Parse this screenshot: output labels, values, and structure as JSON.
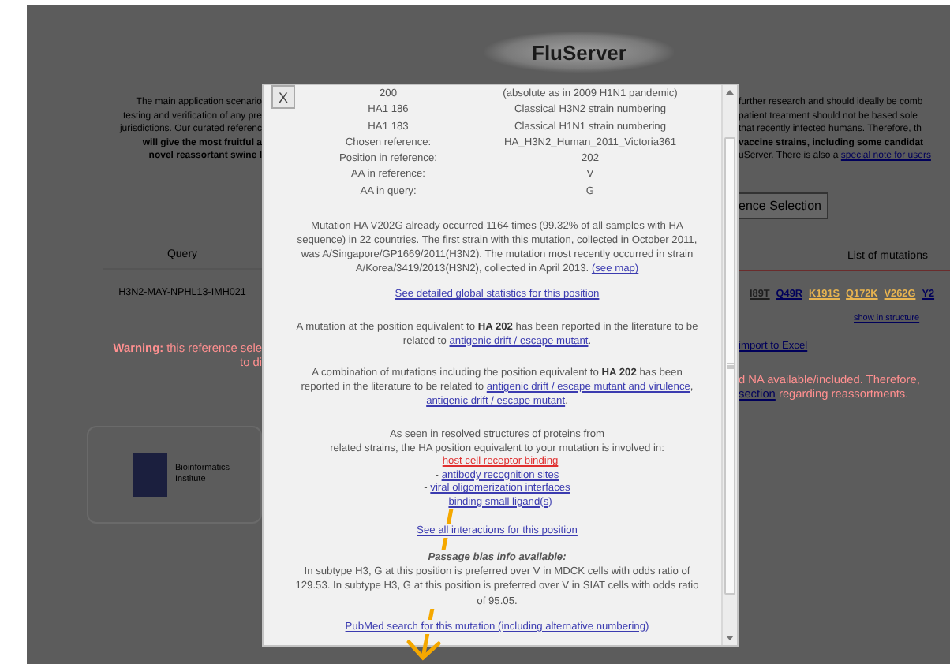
{
  "header": {
    "logo": "FluServer"
  },
  "intro_left": [
    {
      "text": "The main application scenario",
      "bold": false
    },
    {
      "text": "testing and verification of any pre",
      "bold": false
    },
    {
      "text": "jurisdictions. Our curated referenc",
      "bold": false
    },
    {
      "text": "will give the most fruitful a",
      "bold": true
    },
    {
      "text": "novel reassortant swine I",
      "bold": true
    }
  ],
  "intro_right": [
    {
      "text": "further research and should ideally be comb",
      "bold": false
    },
    {
      "text": "patient treatment should not be based sole",
      "bold": false
    },
    {
      "text": "that recently infected humans. Therefore, th",
      "bold": false
    },
    {
      "text": "vaccine strains, including some candidat",
      "bold": true
    },
    {
      "text": "uServer. There is also a",
      "bold": false,
      "link": "special note for users"
    }
  ],
  "reference_button": "ence Selection",
  "table": {
    "columns": [
      "Query",
      "List of mutations"
    ],
    "query": "H3N2-MAY-NPHL13-IMH021",
    "mutations": [
      {
        "text": "I89T",
        "color": "#1e1e1e"
      },
      {
        "text": "Q49R",
        "color": "#00005a"
      },
      {
        "text": "K191S",
        "color": "#e8b450"
      },
      {
        "text": "Q172K",
        "color": "#e8b450"
      },
      {
        "text": "V262G",
        "color": "#e8b450"
      },
      {
        "text": "Y2",
        "color": "#00005a"
      }
    ],
    "structure_link": "show in structure"
  },
  "excel_link": "import to Excel",
  "warning_left": {
    "label": "Warning:",
    "lines": [
      "this reference sele",
      "to di"
    ]
  },
  "warning_right": {
    "line1": "d NA available/included. Therefore,",
    "link": "section",
    "line2": "regarding reassortments."
  },
  "partner_logo": {
    "name": "Bioinformatics Institute"
  },
  "dialog": {
    "close": "X",
    "rows": [
      {
        "label": "200",
        "value": "(absolute as in 2009 H1N1 pandemic)"
      },
      {
        "label": "HA1 186",
        "value": "Classical H3N2 strain numbering"
      },
      {
        "label": "HA1 183",
        "value": "Classical H1N1 strain numbering"
      },
      {
        "label": "Chosen reference:",
        "value": "HA_H3N2_Human_2011_Victoria361"
      },
      {
        "label": "Position in reference:",
        "value": "202"
      },
      {
        "label": "AA in reference:",
        "value": "V"
      },
      {
        "label": "AA in query:",
        "value": "G"
      }
    ],
    "occurrence": {
      "text": "Mutation HA V202G already occurred 1164 times (99.32% of all samples with HA sequence) in 22 countries. The first strain with this mutation, collected in October 2011, was A/Singapore/GP1669/2011(H3N2). The mutation most recently occurred in strain A/Korea/3419/2013(H3N2), collected in April 2013.",
      "link": "(see map)"
    },
    "statistics_link": "See detailed global statistics for this position",
    "literature": [
      {
        "text": "A mutation at the position equivalent to **HA 202** has been reported in the literature to be related to",
        "links": [
          "antigenic drift / escape mutant"
        ],
        "end": "."
      },
      {
        "text": "A combination of mutations including the position equivalent to **HA 202** has been reported in the literature to be related to",
        "links": [
          "antigenic drift / escape mutant and virulence",
          "antigenic drift / escape mutant"
        ],
        "separator": ", ",
        "end": "."
      }
    ],
    "structures": {
      "lines": [
        "As seen in resolved structures of proteins from",
        "related strains, the HA position equivalent to your mutation is involved in:"
      ],
      "items": [
        {
          "bullet": "-",
          "label": "host cell receptor binding",
          "color": "#e03030"
        },
        {
          "bullet": "-",
          "label": "antibody recognition sites",
          "color": "#3b3bb0"
        },
        {
          "bullet": "-",
          "label": "viral oligomerization interfaces",
          "color": "#3b3bb0"
        },
        {
          "bullet": "-",
          "label": "binding small ligand(s)",
          "color": "#3b3bb0"
        }
      ]
    },
    "interactions_link": "See all interactions for this position",
    "passage_bias": {
      "title": "Passage bias info available:",
      "text": "In subtype H3, G at this position is preferred over V in MDCK cells with odds ratio of 129.53. In subtype H3, G at this position is preferred over V in SIAT cells with odds ratio of 95.05."
    },
    "pubmed_link": "PubMed search for this mutation (including alternative numbering)"
  }
}
